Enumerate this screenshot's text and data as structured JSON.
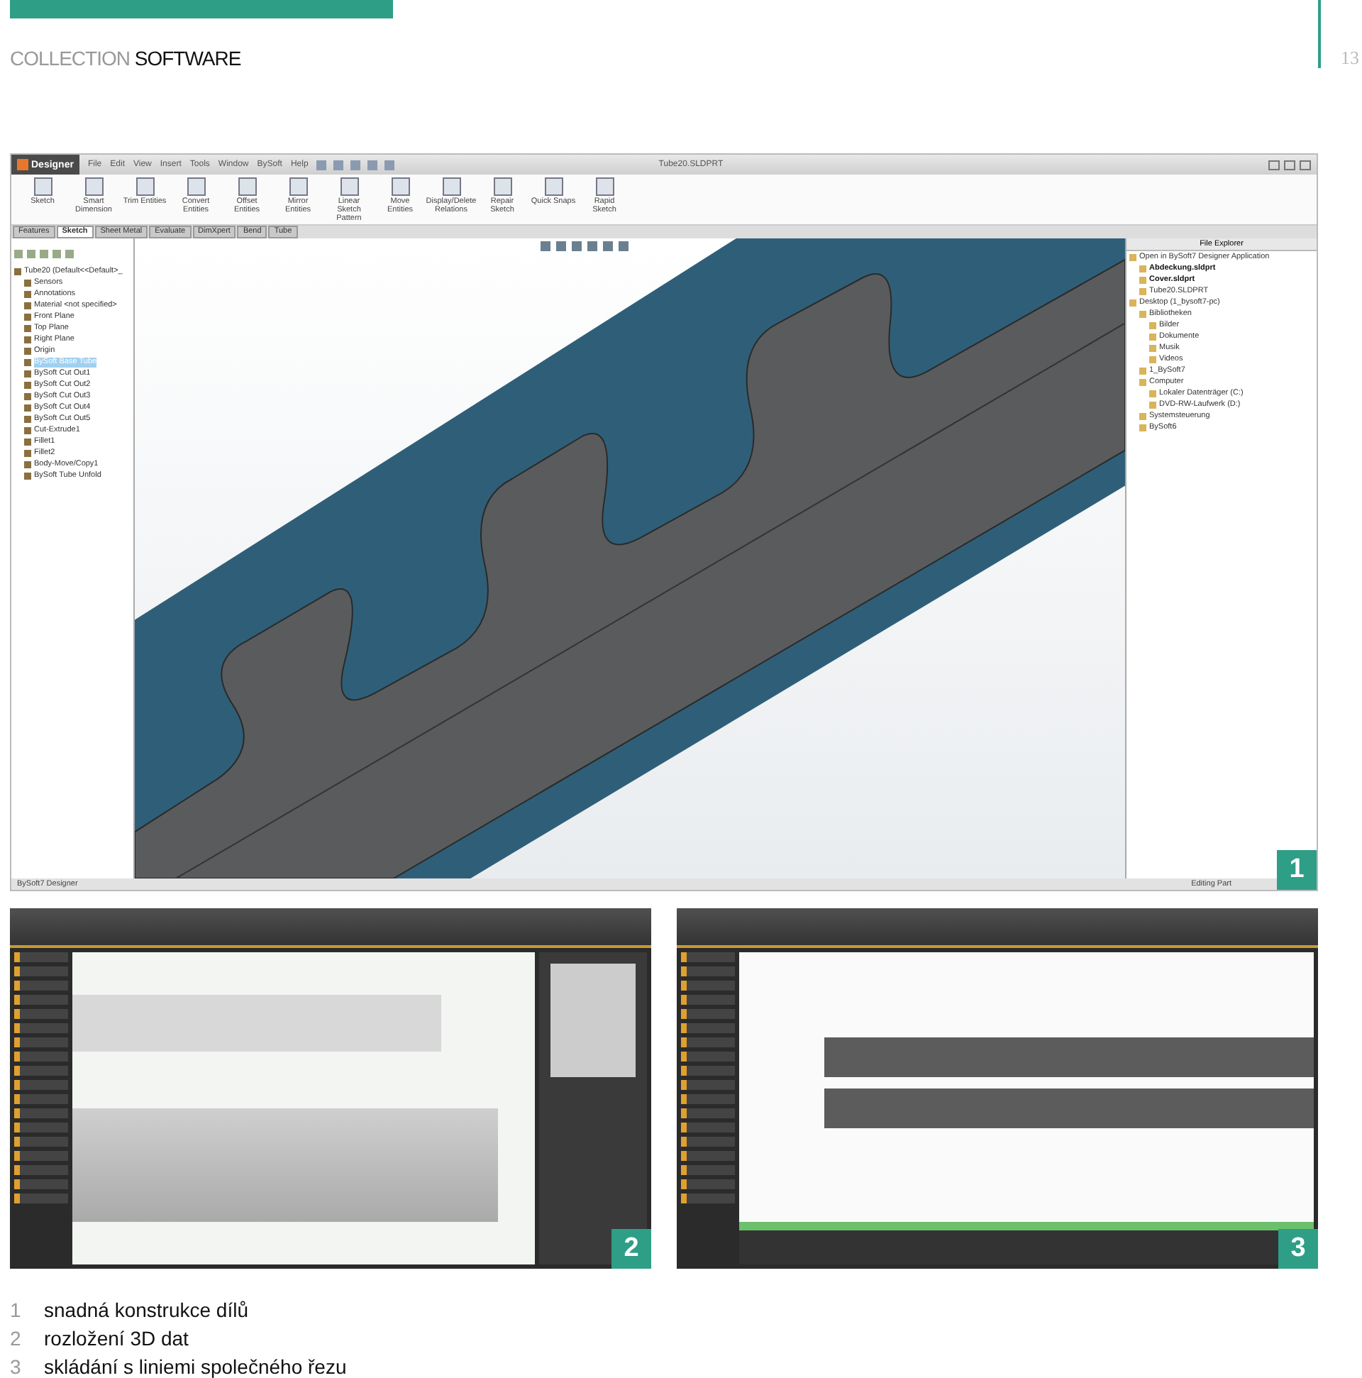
{
  "header": {
    "brand_light": "COLLECTION",
    "brand_dark": "SOFTWARE",
    "page_number": "13"
  },
  "screenshot_1": {
    "app_name": "Designer",
    "menu": [
      "File",
      "Edit",
      "View",
      "Insert",
      "Tools",
      "Window",
      "BySoft",
      "Help"
    ],
    "document_title": "Tube20.SLDPRT",
    "ribbon": [
      {
        "label": "Sketch"
      },
      {
        "label": "Smart Dimension"
      },
      {
        "label": "Trim Entities"
      },
      {
        "label": "Convert Entities"
      },
      {
        "label": "Offset Entities"
      },
      {
        "label": "Mirror Entities"
      },
      {
        "label": "Linear Sketch Pattern"
      },
      {
        "label": "Move Entities"
      },
      {
        "label": "Display/Delete Relations"
      },
      {
        "label": "Repair Sketch"
      },
      {
        "label": "Quick Snaps"
      },
      {
        "label": "Rapid Sketch"
      }
    ],
    "tabs": [
      {
        "label": "Features",
        "selected": false
      },
      {
        "label": "Sketch",
        "selected": true
      },
      {
        "label": "Sheet Metal",
        "selected": false
      },
      {
        "label": "Evaluate",
        "selected": false
      },
      {
        "label": "DimXpert",
        "selected": false
      },
      {
        "label": "Bend",
        "selected": false
      },
      {
        "label": "Tube",
        "selected": false
      }
    ],
    "feature_tree": [
      {
        "label": "Tube20 (Default<<Default>_",
        "selected": false,
        "children": [
          {
            "label": "Sensors",
            "selected": false
          },
          {
            "label": "Annotations",
            "selected": false
          },
          {
            "label": "Material <not specified>",
            "selected": false
          },
          {
            "label": "Front Plane",
            "selected": false
          },
          {
            "label": "Top Plane",
            "selected": false
          },
          {
            "label": "Right Plane",
            "selected": false
          },
          {
            "label": "Origin",
            "selected": false
          },
          {
            "label": "BySoft Base Tube",
            "selected": true
          },
          {
            "label": "BySoft Cut Out1",
            "selected": false
          },
          {
            "label": "BySoft Cut Out2",
            "selected": false
          },
          {
            "label": "BySoft Cut Out3",
            "selected": false
          },
          {
            "label": "BySoft Cut Out4",
            "selected": false
          },
          {
            "label": "BySoft Cut Out5",
            "selected": false
          },
          {
            "label": "Cut-Extrude1",
            "selected": false
          },
          {
            "label": "Fillet1",
            "selected": false
          },
          {
            "label": "Fillet2",
            "selected": false
          },
          {
            "label": "Body-Move/Copy1",
            "selected": false
          },
          {
            "label": "BySoft Tube Unfold",
            "selected": false
          }
        ]
      }
    ],
    "file_explorer": {
      "title": "File Explorer",
      "items": [
        {
          "label": "Open in BySoft7 Designer Application",
          "bold": false,
          "children": [
            {
              "label": "Abdeckung.sldprt",
              "bold": true
            },
            {
              "label": "Cover.sldprt",
              "bold": true
            },
            {
              "label": "Tube20.SLDPRT",
              "bold": false
            }
          ]
        },
        {
          "label": "Desktop (1_bysoft7-pc)",
          "bold": false,
          "children": [
            {
              "label": "Bibliotheken",
              "bold": false,
              "children": [
                {
                  "label": "Bilder",
                  "bold": false
                },
                {
                  "label": "Dokumente",
                  "bold": false
                },
                {
                  "label": "Musik",
                  "bold": false
                },
                {
                  "label": "Videos",
                  "bold": false
                }
              ]
            },
            {
              "label": "1_BySoft7",
              "bold": false
            },
            {
              "label": "Computer",
              "bold": false,
              "children": [
                {
                  "label": "Lokaler Datenträger (C:)",
                  "bold": false
                },
                {
                  "label": "DVD-RW-Laufwerk (D:)",
                  "bold": false
                }
              ]
            },
            {
              "label": "Systemsteuerung",
              "bold": false
            },
            {
              "label": "BySoft6",
              "bold": false
            }
          ]
        }
      ]
    },
    "status_left": "BySoft7 Designer",
    "status_right": "Editing Part",
    "badge": "1"
  },
  "screenshot_2": {
    "badge": "2"
  },
  "screenshot_3": {
    "badge": "3"
  },
  "captions": [
    {
      "number": "1",
      "text": "snadná konstrukce dílů"
    },
    {
      "number": "2",
      "text": "rozložení 3D dat"
    },
    {
      "number": "3",
      "text": "skládání s liniemi společného řezu"
    }
  ]
}
